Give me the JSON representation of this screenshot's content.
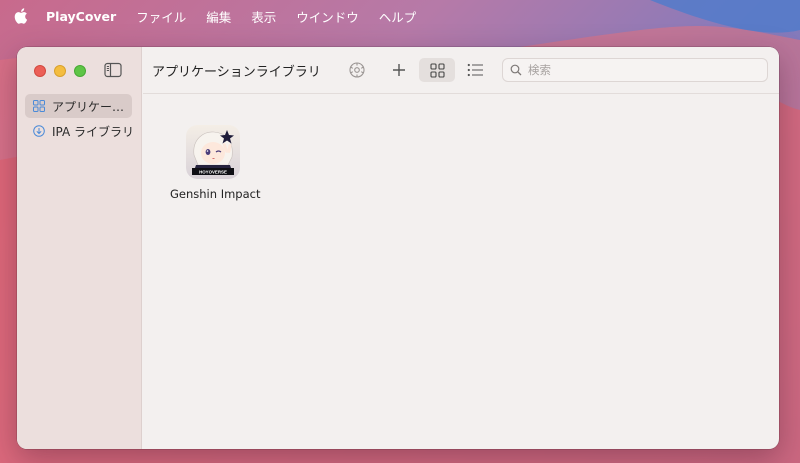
{
  "menubar": {
    "app_name": "PlayCover",
    "items": [
      "ファイル",
      "編集",
      "表示",
      "ウインドウ",
      "ヘルプ"
    ]
  },
  "sidebar": {
    "items": [
      {
        "label": "アプリケー…",
        "icon": "grid-icon",
        "selected": true
      },
      {
        "label": "IPA ライブラリ",
        "icon": "download-circle-icon",
        "selected": false
      }
    ]
  },
  "toolbar": {
    "title": "アプリケーションライブラリ",
    "search_placeholder": "検索"
  },
  "apps": [
    {
      "name": "Genshin Impact",
      "badge": "HOYOVERSE"
    }
  ],
  "colors": {
    "close": "#ec5f57",
    "minimize": "#f4bd40",
    "maximize": "#5ec546",
    "sidebar_bg": "#ecdfdd",
    "content_bg": "#f3f0ef",
    "selected_bg": "#d9cbc9"
  }
}
